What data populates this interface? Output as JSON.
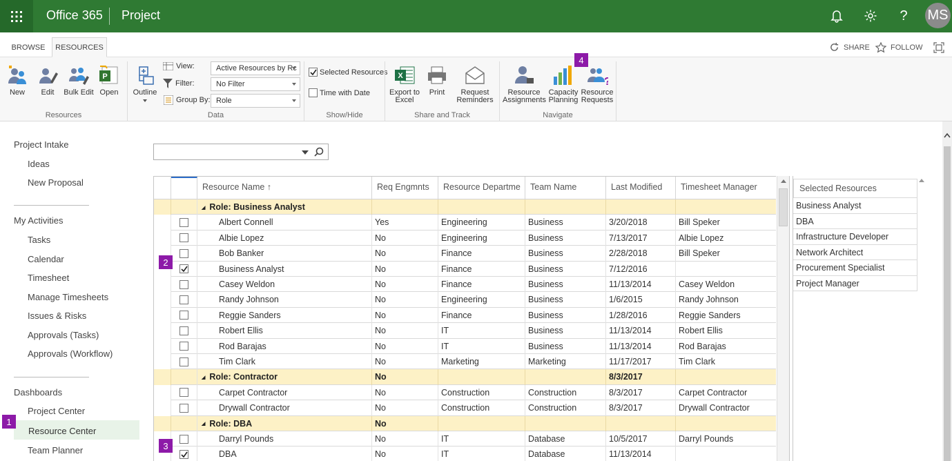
{
  "topbar": {
    "brand": "Office 365",
    "app": "Project",
    "avatar_initials": "MS",
    "color": "#2f7a33",
    "icons": [
      "waffle-icon",
      "bell-icon",
      "gear-icon",
      "help-icon"
    ]
  },
  "tabs": [
    {
      "label": "BROWSE"
    },
    {
      "label": "RESOURCES",
      "active": true
    }
  ],
  "actions": {
    "share": "SHARE",
    "follow": "FOLLOW"
  },
  "ribbon": {
    "resources": {
      "new": "New",
      "edit": "Edit",
      "bulk_edit": "Bulk Edit",
      "open": "Open",
      "label": "Resources"
    },
    "data": {
      "outline": "Outline",
      "view_label": "View:",
      "view_value": "Active Resources by Rc",
      "filter_label": "Filter:",
      "filter_value": "No Filter",
      "groupby_label": "Group By:",
      "groupby_value": "Role",
      "label": "Data"
    },
    "showhide": {
      "selected_resources": "Selected Resources",
      "time_with_date": "Time with Date",
      "label": "Show/Hide",
      "selected_checked": true,
      "time_checked": false
    },
    "share": {
      "export": "Export to Excel",
      "print": "Print",
      "reminders": "Request Reminders",
      "label": "Share and Track"
    },
    "navigate": {
      "assignments": "Resource Assignments",
      "capacity": "Capacity Planning",
      "requests": "Resource Requests",
      "label": "Navigate"
    }
  },
  "nav": {
    "project_intake": "Project Intake",
    "ideas": "Ideas",
    "new_proposal": "New Proposal",
    "my_activities": "My Activities",
    "tasks": "Tasks",
    "calendar": "Calendar",
    "timesheet": "Timesheet",
    "manage_timesheets": "Manage Timesheets",
    "issues_risks": "Issues & Risks",
    "approvals_tasks": "Approvals (Tasks)",
    "approvals_workflow": "Approvals (Workflow)",
    "dashboards": "Dashboards",
    "project_center": "Project Center",
    "resource_center": "Resource Center",
    "team_planner": "Team Planner"
  },
  "badges": [
    "1",
    "2",
    "3",
    "4"
  ],
  "grid": {
    "headers": [
      "Resource Name ↑",
      "Req Engmnts",
      "Resource Departme",
      "Team Name",
      "Last Modified",
      "Timesheet Manager"
    ],
    "rows": [
      {
        "type": "group",
        "name": "Role: Business Analyst",
        "req": "",
        "modified": ""
      },
      {
        "type": "item",
        "checked": false,
        "name": "Albert Connell",
        "req": "Yes",
        "dept": "Engineering",
        "team": "Business",
        "modified": "3/20/2018",
        "manager": "Bill Speker"
      },
      {
        "type": "item",
        "checked": false,
        "name": "Albie Lopez",
        "req": "No",
        "dept": "Engineering",
        "team": "Business",
        "modified": "7/13/2017",
        "manager": "Albie Lopez"
      },
      {
        "type": "item",
        "checked": false,
        "name": "Bob Banker",
        "req": "No",
        "dept": "Finance",
        "team": "Business",
        "modified": "2/28/2018",
        "manager": "Bill Speker"
      },
      {
        "type": "item",
        "checked": true,
        "name": "Business Analyst",
        "req": "No",
        "dept": "Finance",
        "team": "Business",
        "modified": "7/12/2016",
        "manager": ""
      },
      {
        "type": "item",
        "checked": false,
        "name": "Casey Weldon",
        "req": "No",
        "dept": "Finance",
        "team": "Business",
        "modified": "11/13/2014",
        "manager": "Casey Weldon"
      },
      {
        "type": "item",
        "checked": false,
        "name": "Randy Johnson",
        "req": "No",
        "dept": "Engineering",
        "team": "Business",
        "modified": "1/6/2015",
        "manager": "Randy Johnson"
      },
      {
        "type": "item",
        "checked": false,
        "name": "Reggie Sanders",
        "req": "No",
        "dept": "Finance",
        "team": "Business",
        "modified": "1/28/2016",
        "manager": "Reggie Sanders"
      },
      {
        "type": "item",
        "checked": false,
        "name": "Robert Ellis",
        "req": "No",
        "dept": "IT",
        "team": "Business",
        "modified": "11/13/2014",
        "manager": "Robert Ellis"
      },
      {
        "type": "item",
        "checked": false,
        "name": "Rod Barajas",
        "req": "No",
        "dept": "IT",
        "team": "Business",
        "modified": "11/13/2014",
        "manager": "Rod Barajas"
      },
      {
        "type": "item",
        "checked": false,
        "name": "Tim Clark",
        "req": "No",
        "dept": "Marketing",
        "team": "Marketing",
        "modified": "11/17/2017",
        "manager": "Tim Clark"
      },
      {
        "type": "group",
        "name": "Role: Contractor",
        "req": "No",
        "modified": "8/3/2017"
      },
      {
        "type": "item",
        "checked": false,
        "name": "Carpet Contractor",
        "req": "No",
        "dept": "Construction",
        "team": "Construction",
        "modified": "8/3/2017",
        "manager": "Carpet Contractor"
      },
      {
        "type": "item",
        "checked": false,
        "name": "Drywall Contractor",
        "req": "No",
        "dept": "Construction",
        "team": "Construction",
        "modified": "8/3/2017",
        "manager": "Drywall Contractor"
      },
      {
        "type": "group",
        "name": "Role: DBA",
        "req": "No",
        "modified": ""
      },
      {
        "type": "item",
        "checked": false,
        "name": "Darryl Pounds",
        "req": "No",
        "dept": "IT",
        "team": "Database",
        "modified": "10/5/2017",
        "manager": "Darryl Pounds"
      },
      {
        "type": "item",
        "checked": true,
        "name": "DBA",
        "req": "No",
        "dept": "IT",
        "team": "Database",
        "modified": "11/13/2014",
        "manager": ""
      }
    ]
  },
  "selected_panel": {
    "title": "Selected Resources",
    "items": [
      "Business Analyst",
      "DBA",
      "Infrastructure Developer",
      "Network Architect",
      "Procurement Specialist",
      "Project Manager"
    ]
  }
}
